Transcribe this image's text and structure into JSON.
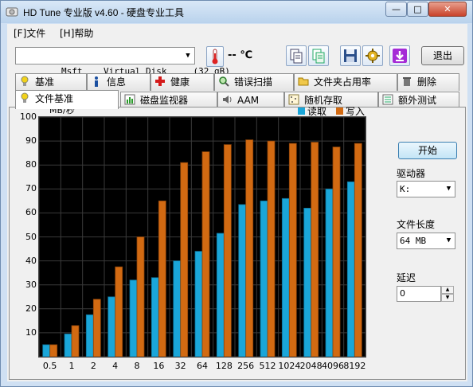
{
  "window": {
    "title": "HD Tune 专业版 v4.60 - 硬盘专业工具",
    "min": "—",
    "max": "□",
    "close": "✕"
  },
  "menu": {
    "file": "[F]文件",
    "help": "[H]帮助"
  },
  "toolbar": {
    "drive": "Msft    Virtual Disk     (32 gB)",
    "temperature": "-- ℃",
    "exit": "退出",
    "icons": [
      "copy-icon",
      "copy-all-icon",
      "save-icon",
      "options-icon",
      "download-icon"
    ]
  },
  "tabs_top": [
    "基准",
    "信息",
    "健康",
    "错误扫描",
    "文件夹占用率",
    "删除"
  ],
  "tabs_bottom": [
    "文件基准",
    "磁盘监视器",
    "AAM",
    "随机存取",
    "额外测试"
  ],
  "active_tab": "文件基准",
  "side": {
    "start": "开始",
    "drive_label": "驱动器",
    "drive_value": "K:",
    "filesize_label": "文件长度",
    "filesize_value": "64 MB",
    "delay_label": "延迟",
    "delay_value": "0"
  },
  "chart_data": {
    "type": "bar",
    "ylabel": "MB/秒",
    "ylim": [
      0,
      100
    ],
    "yticks": [
      10,
      20,
      30,
      40,
      50,
      60,
      70,
      80,
      90,
      100
    ],
    "categories": [
      "0.5",
      "1",
      "2",
      "4",
      "8",
      "16",
      "32",
      "64",
      "128",
      "256",
      "512",
      "1024",
      "2048",
      "4096",
      "8192"
    ],
    "series": [
      {
        "name": "读取",
        "color": "#1aa6d9",
        "values": [
          5,
          9.5,
          17.5,
          25,
          32,
          33,
          40,
          44,
          51.5,
          63.5,
          65,
          66,
          62,
          70,
          73
        ]
      },
      {
        "name": "写入",
        "color": "#d26a12",
        "values": [
          5,
          13,
          24,
          37.5,
          50,
          65,
          81,
          85.5,
          88.5,
          90.5,
          90,
          89,
          89.5,
          87.5,
          89
        ]
      }
    ],
    "grid": true,
    "legend": "top-right"
  }
}
